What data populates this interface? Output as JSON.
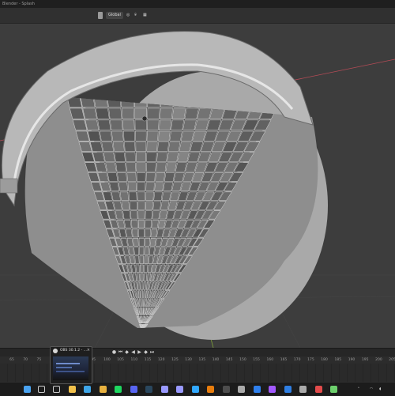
{
  "window": {
    "title": "Blender - Splash"
  },
  "header": {
    "orientation_label": "Global",
    "pivot_icon": "transform-pivot-icon",
    "snap_icon": "magnet-icon"
  },
  "timeline": {
    "frame_ticks": [
      "65",
      "70",
      "75",
      "80",
      "85",
      "90",
      "95",
      "100",
      "105",
      "110",
      "115",
      "120",
      "125",
      "130",
      "135",
      "140",
      "145",
      "150",
      "155",
      "160",
      "165",
      "170",
      "175",
      "180",
      "185",
      "190",
      "195",
      "200",
      "205"
    ],
    "controls": [
      "record-icon",
      "jump-start-icon",
      "prev-keyframe-icon",
      "play-reverse-icon",
      "play-icon",
      "next-keyframe-icon",
      "jump-end-icon"
    ]
  },
  "obs_preview": {
    "label": "OBS 30.1.2 - ..."
  },
  "taskbar": {
    "icons": [
      "windows-start-icon",
      "search-icon",
      "task-view-icon",
      "file-explorer-icon",
      "edge-icon",
      "chrome-icon",
      "spotify-icon",
      "discord-icon",
      "steam-icon",
      "premiere-icon",
      "after-effects-icon",
      "photoshop-icon",
      "blender-icon",
      "obs-icon",
      "unity-icon",
      "vscode-icon",
      "figma-icon",
      "mail-icon",
      "settings-icon",
      "app-icon",
      "app-icon-2"
    ],
    "colors": [
      "#4aa3f0",
      "#cccccc",
      "#cccccc",
      "#f2c14b",
      "#3fa6e8",
      "#e8b13f",
      "#1ed760",
      "#5865f2",
      "#2a475e",
      "#9999ff",
      "#9999ff",
      "#31a8ff",
      "#e87d0d",
      "#4d4d4d",
      "#aaaaaa",
      "#2f80ed",
      "#a259ff",
      "#2f7fe3",
      "#aaaaaa",
      "#e34b4b",
      "#6ccf6c"
    ]
  },
  "accents": {
    "x_axis": "#b54b56",
    "y_axis": "#7fa33a",
    "background": "#3d3d3d"
  }
}
